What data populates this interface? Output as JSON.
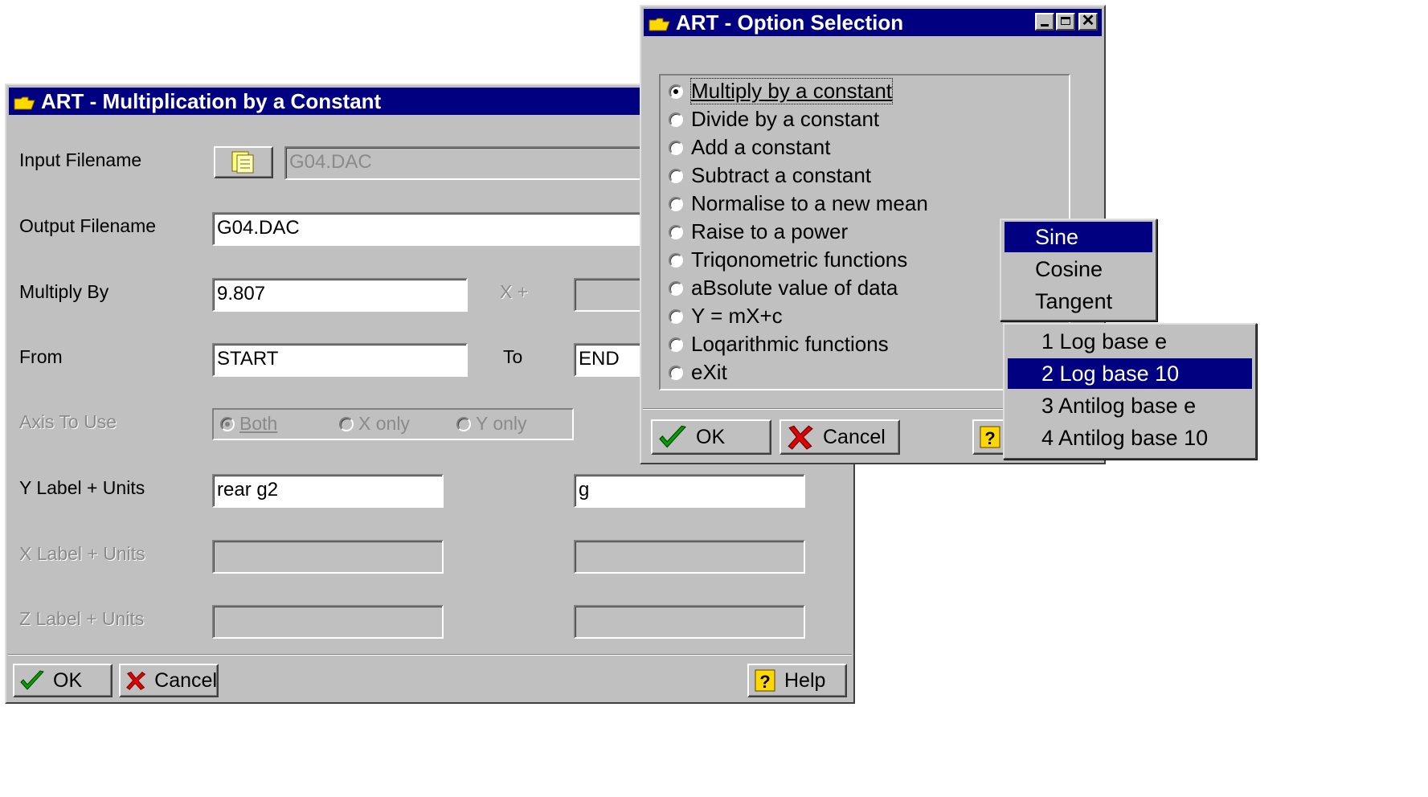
{
  "mult_dialog": {
    "title": "ART -  Multiplication by a Constant",
    "input_filename_label": "Input Filename",
    "input_filename_value": "G04.DAC",
    "output_filename_label": "Output Filename",
    "output_filename_value": "G04.DAC",
    "multiply_by_label": "Multiply By",
    "multiply_by_value": "9.807",
    "x_plus_label": "X +",
    "x_plus_value": "",
    "from_label": "From",
    "from_value": "START",
    "to_label": "To",
    "to_value": "END",
    "axis_label": "Axis To Use",
    "axis_options": [
      "Both",
      "X only",
      "Y only"
    ],
    "axis_selected": "Both",
    "y_label": "Y Label + Units",
    "y_label_value": "rear g2",
    "y_units_value": "g",
    "x_label": "X Label + Units",
    "z_label": "Z Label + Units",
    "ok_label": "OK",
    "cancel_label": "Cancel",
    "help_label": "Help"
  },
  "option_dialog": {
    "title": "ART -  Option Selection",
    "options": [
      {
        "label": "Multiply by a constant",
        "selected": true
      },
      {
        "label": "Divide by a constant",
        "selected": false
      },
      {
        "label": "Add a constant",
        "selected": false
      },
      {
        "label": "Subtract a constant",
        "selected": false
      },
      {
        "label": "Normalise to a new mean",
        "selected": false
      },
      {
        "label": "Raise to a power",
        "selected": false
      },
      {
        "label": "Triqonometric functions",
        "selected": false
      },
      {
        "label": "aBsolute value of data",
        "selected": false
      },
      {
        "label": "Y = mX+c",
        "selected": false
      },
      {
        "label": "Loqarithmic functions",
        "selected": false
      },
      {
        "label": "eXit",
        "selected": false
      }
    ],
    "ok_label": "OK",
    "cancel_label": "Cancel"
  },
  "trig_menu": {
    "items": [
      "Sine",
      "Cosine",
      "Tangent"
    ],
    "selected": "Sine"
  },
  "log_menu": {
    "items": [
      "1 Log base e",
      "2 Log base 10",
      "3 Antilog base e",
      "4 Antilog base 10"
    ],
    "selected": "2 Log base 10"
  },
  "colors": {
    "title_bar": "#000080",
    "dialog_face": "#c0c0c0",
    "highlight": "#000080"
  },
  "icons": {
    "window": "folder-icon",
    "ok": "checkmark-icon",
    "cancel": "red-x-icon",
    "help": "help-icon",
    "browse": "file-browse-icon"
  }
}
